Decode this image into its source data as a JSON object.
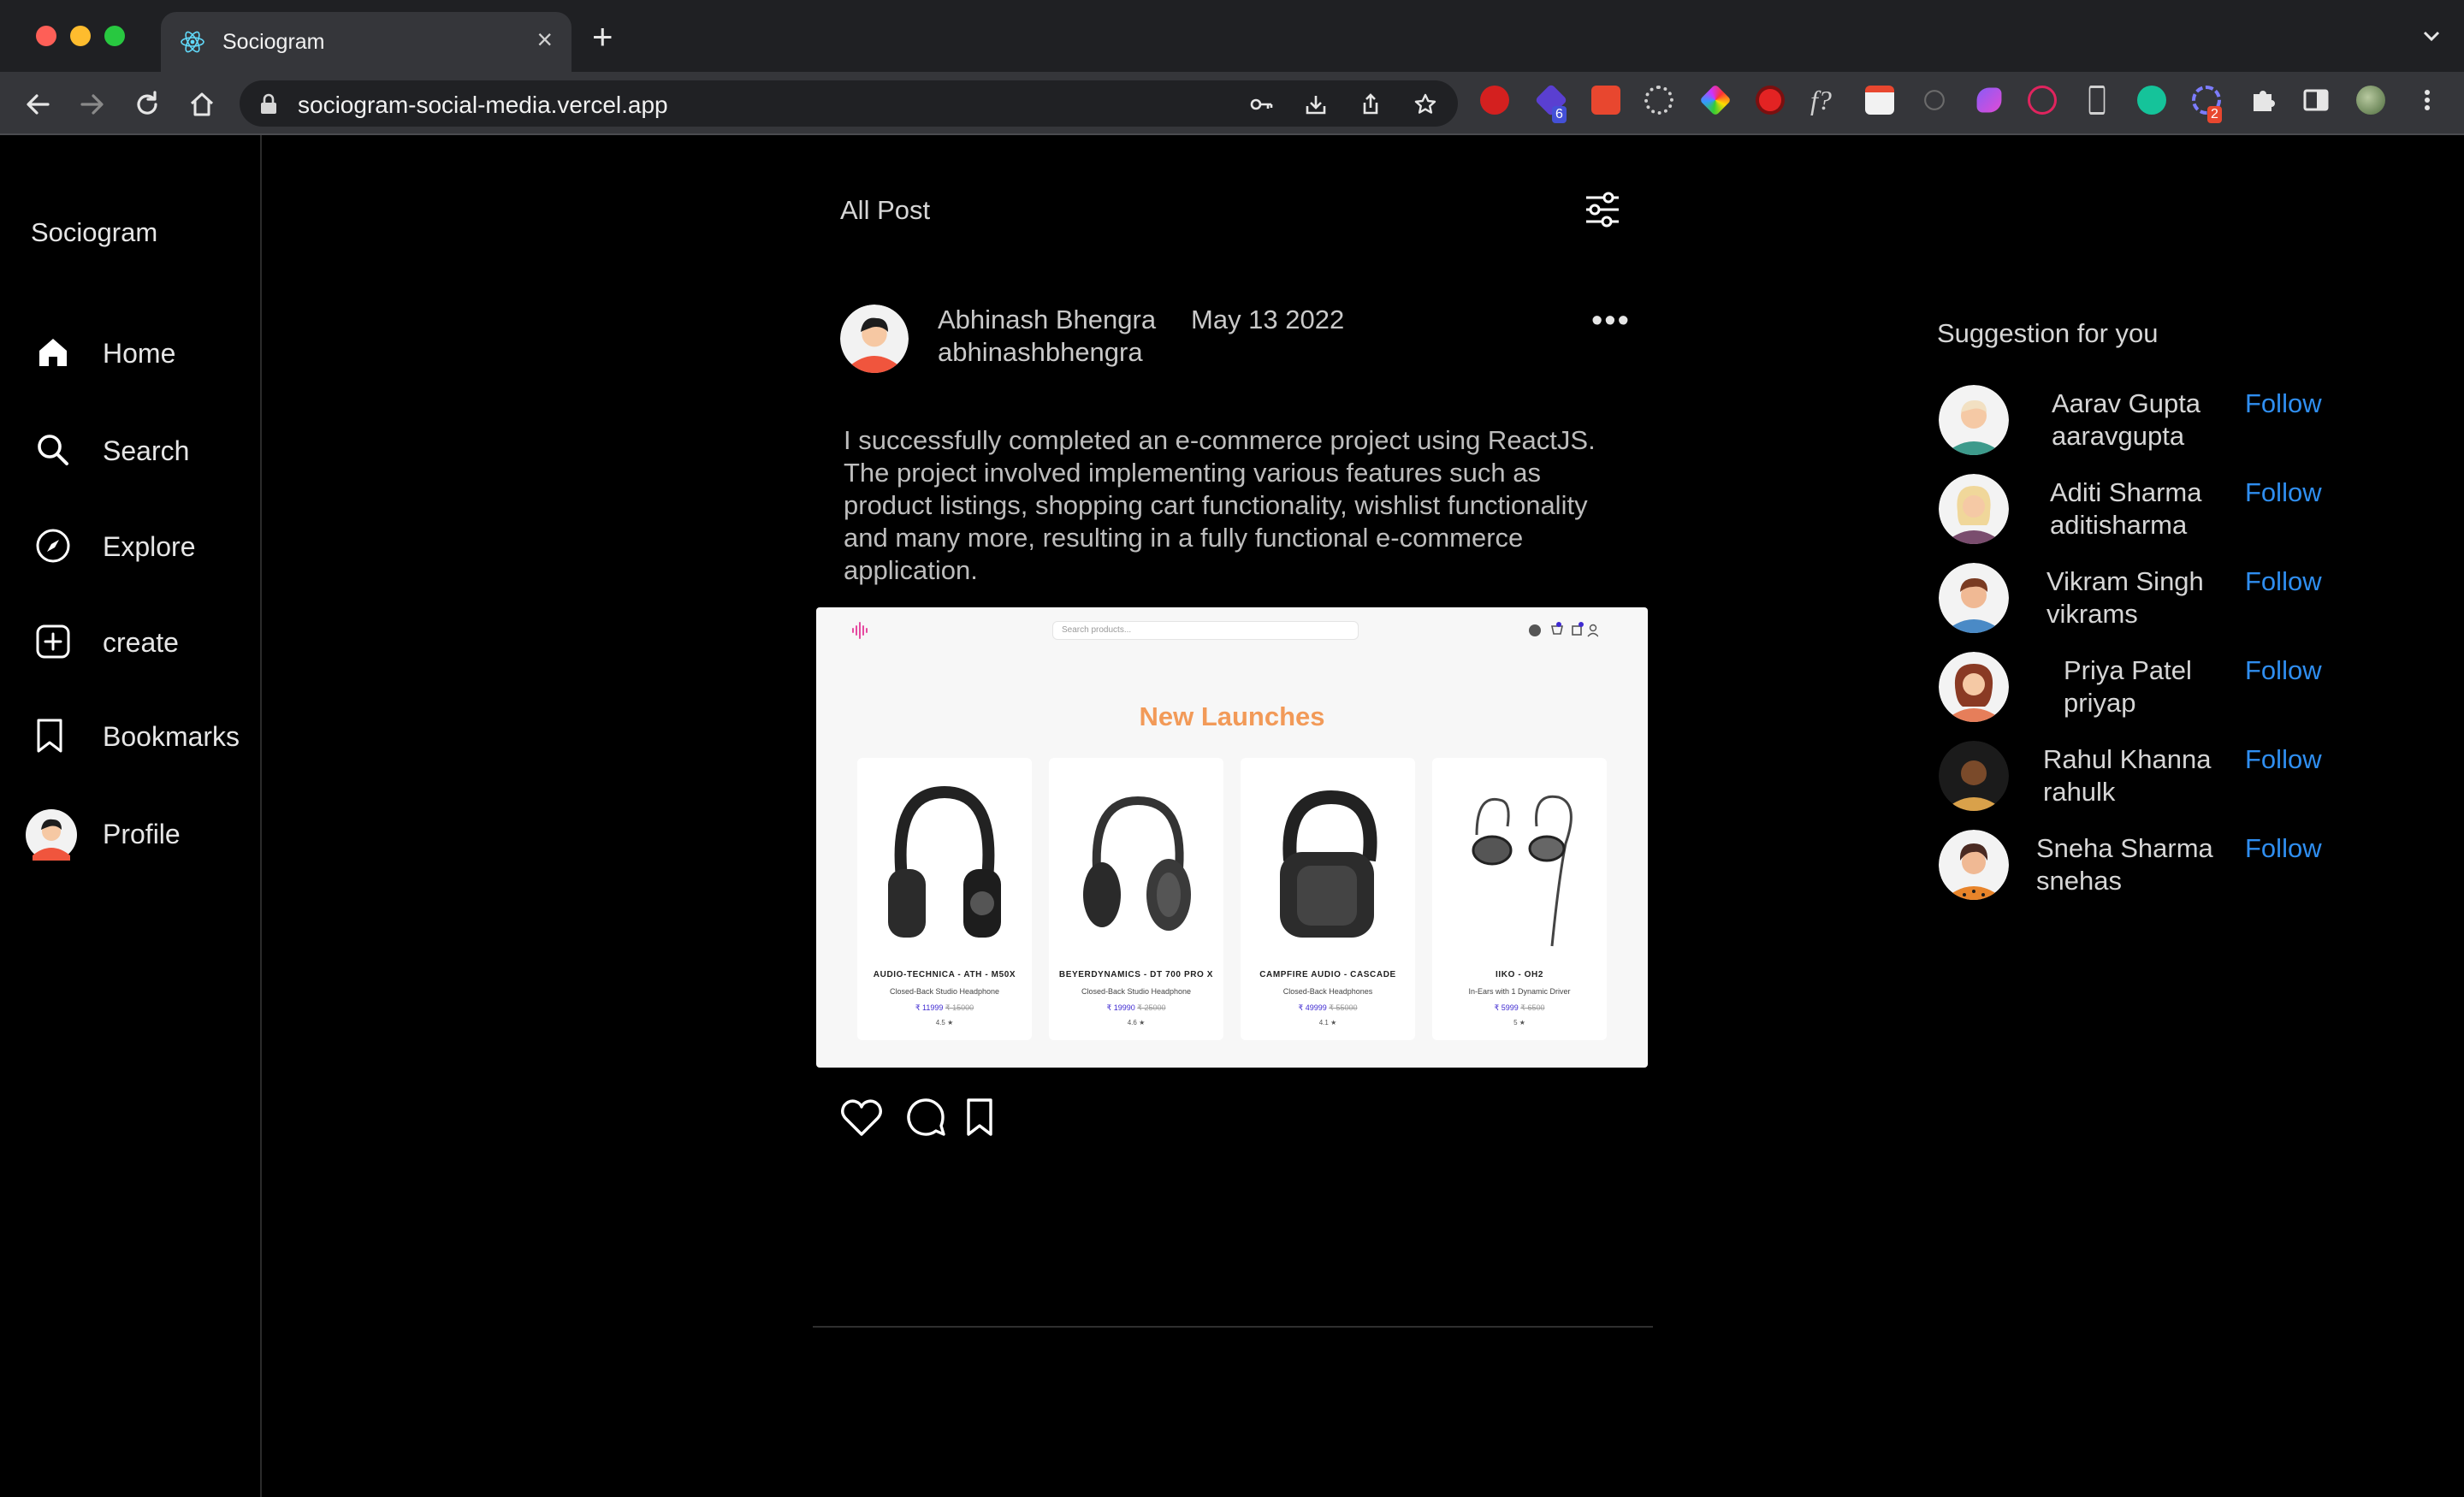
{
  "browser": {
    "tab_title": "Sociogram",
    "url": "sociogram-social-media.vercel.app",
    "ext_badges": {
      "first": "6",
      "second": "2"
    }
  },
  "sidebar": {
    "brand": "Sociogram",
    "items": [
      {
        "label": "Home",
        "icon": "home-icon"
      },
      {
        "label": "Search",
        "icon": "search-icon"
      },
      {
        "label": "Explore",
        "icon": "compass-icon"
      },
      {
        "label": "create",
        "icon": "plus-square-icon"
      },
      {
        "label": "Bookmarks",
        "icon": "bookmark-icon"
      },
      {
        "label": "Profile",
        "icon": "avatar"
      }
    ]
  },
  "feed": {
    "title": "All Post",
    "post": {
      "author_name": "Abhinash Bhengra",
      "date": "May 13 2022",
      "username": "abhinashbhengra",
      "text": "I successfully completed an e-commerce project using ReactJS. The project involved implementing various features such as product listings, shopping cart functionality, wishlist functionality and many more, resulting in a fully functional e-commerce application.",
      "image": {
        "search_placeholder": "Search products...",
        "heading": "New Launches",
        "products": [
          {
            "name": "AUDIO-TECHNICA - ATH - M50X",
            "desc": "Closed-Back Studio Headphone",
            "price": "₹ 11999",
            "old_price": "₹ 15000",
            "rating": "4.5 ★"
          },
          {
            "name": "BEYERDYNAMICS - DT 700 PRO X",
            "desc": "Closed-Back Studio Headphone",
            "price": "₹ 19990",
            "old_price": "₹ 25000",
            "rating": "4.6 ★"
          },
          {
            "name": "CAMPFIRE AUDIO - CASCADE",
            "desc": "Closed-Back Headphones",
            "price": "₹ 49999",
            "old_price": "₹ 55000",
            "rating": "4.1 ★"
          },
          {
            "name": "IIKO - OH2",
            "desc": "In-Ears with 1 Dynamic Driver",
            "price": "₹ 5999",
            "old_price": "₹ 6500",
            "rating": "5 ★"
          }
        ]
      }
    }
  },
  "suggestions": {
    "title": "Suggestion for you",
    "follow_label": "Follow",
    "users": [
      {
        "name": "Aarav Gupta",
        "username": "aaravgupta"
      },
      {
        "name": "Aditi Sharma",
        "username": "aditisharma"
      },
      {
        "name": "Vikram Singh",
        "username": "vikrams"
      },
      {
        "name": "Priya Patel",
        "username": "priyap"
      },
      {
        "name": "Rahul Khanna",
        "username": "rahulk"
      },
      {
        "name": "Sneha Sharma",
        "username": "snehas"
      }
    ]
  },
  "colors": {
    "background": "#000000",
    "accent_follow": "#2f8ef0",
    "heading_orange": "#f29a58",
    "price_purple": "#3f2ad1"
  }
}
